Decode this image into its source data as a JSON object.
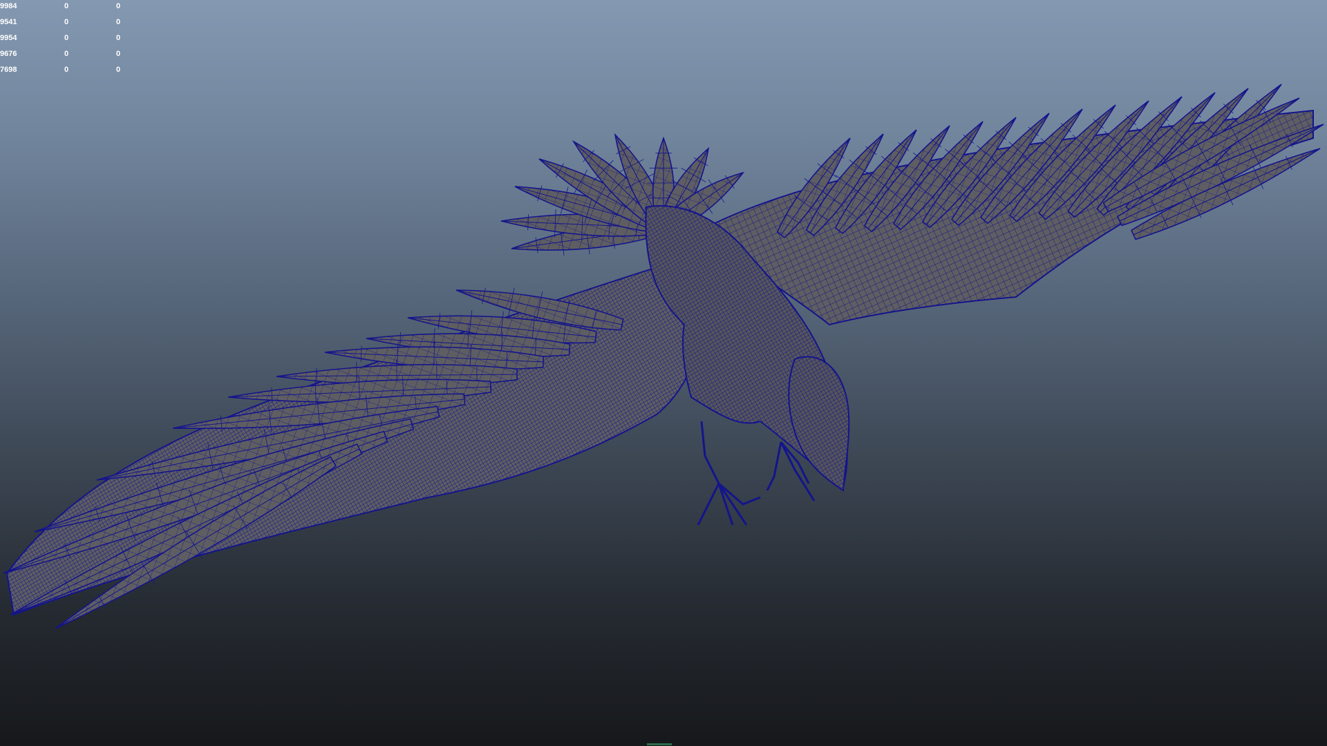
{
  "viewport": {
    "background_top": "#8498b1",
    "background_bottom": "#16181b"
  },
  "hud": {
    "rows": [
      {
        "c1": "9984",
        "c2": "0",
        "c3": "0"
      },
      {
        "c1": "9541",
        "c2": "0",
        "c3": "0"
      },
      {
        "c1": "9954",
        "c2": "0",
        "c3": "0"
      },
      {
        "c1": "9676",
        "c2": "0",
        "c3": "0"
      },
      {
        "c1": "7698",
        "c2": "0",
        "c3": "0"
      }
    ]
  },
  "model": {
    "wireframe_color": "#14148c",
    "shaded_color": "#5e5e62"
  }
}
